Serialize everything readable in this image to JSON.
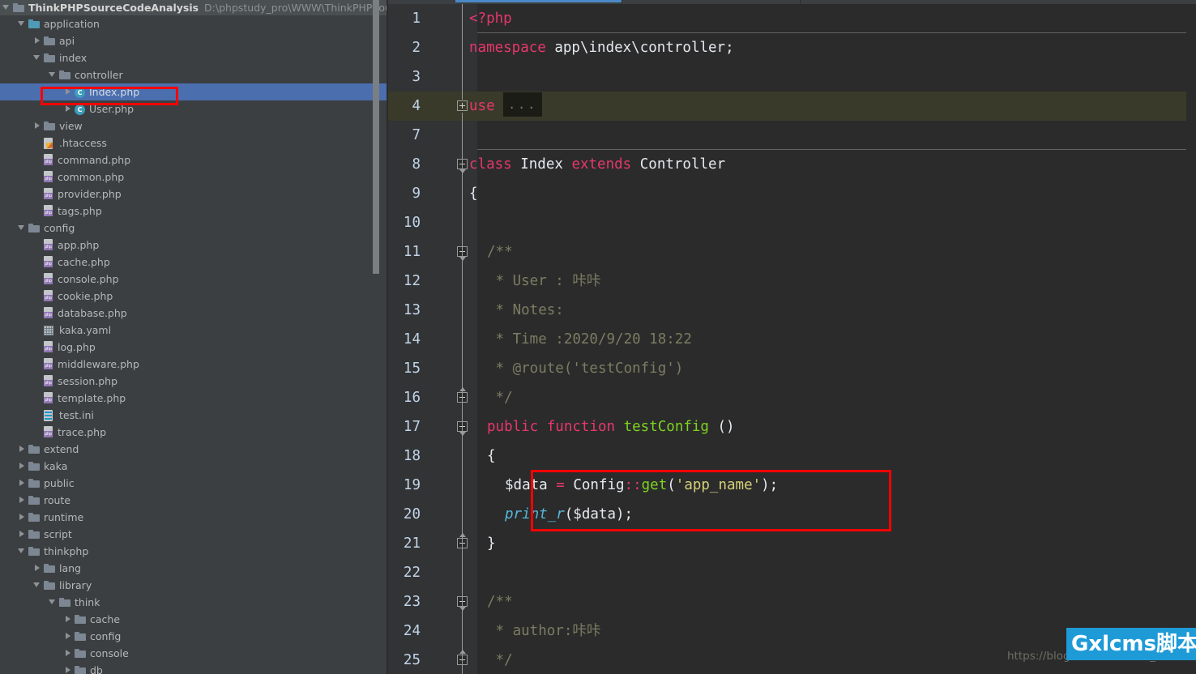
{
  "project": {
    "name": "ThinkPHPSourceCodeAnalysis",
    "path": "D:\\phpstudy_pro\\WWW\\ThinkPHPSourceC",
    "expander": "expanded-triangle-icon",
    "folder_icon": "folder-icon"
  },
  "tree": {
    "items": [
      {
        "label": "application",
        "indent": 1,
        "state": "expanded",
        "icon": "folder-src-icon",
        "selected": false
      },
      {
        "label": "api",
        "indent": 2,
        "state": "collapsed",
        "icon": "folder-icon",
        "selected": false
      },
      {
        "label": "index",
        "indent": 2,
        "state": "expanded",
        "icon": "folder-icon",
        "selected": false
      },
      {
        "label": "controller",
        "indent": 3,
        "state": "expanded",
        "icon": "folder-icon",
        "selected": false
      },
      {
        "label": "Index.php",
        "indent": 4,
        "state": "collapsed",
        "icon": "php-class-icon",
        "selected": true
      },
      {
        "label": "User.php",
        "indent": 4,
        "state": "collapsed",
        "icon": "php-class-icon",
        "selected": false
      },
      {
        "label": "view",
        "indent": 2,
        "state": "collapsed",
        "icon": "folder-icon",
        "selected": false
      },
      {
        "label": ".htaccess",
        "indent": 2,
        "state": "leaf",
        "icon": "htaccess-icon",
        "selected": false
      },
      {
        "label": "command.php",
        "indent": 2,
        "state": "leaf",
        "icon": "php-file-icon",
        "selected": false
      },
      {
        "label": "common.php",
        "indent": 2,
        "state": "leaf",
        "icon": "php-file-icon",
        "selected": false
      },
      {
        "label": "provider.php",
        "indent": 2,
        "state": "leaf",
        "icon": "php-file-icon",
        "selected": false
      },
      {
        "label": "tags.php",
        "indent": 2,
        "state": "leaf",
        "icon": "php-file-icon",
        "selected": false
      },
      {
        "label": "config",
        "indent": 1,
        "state": "expanded",
        "icon": "folder-icon",
        "selected": false
      },
      {
        "label": "app.php",
        "indent": 2,
        "state": "leaf",
        "icon": "php-file-icon",
        "selected": false
      },
      {
        "label": "cache.php",
        "indent": 2,
        "state": "leaf",
        "icon": "php-file-icon",
        "selected": false
      },
      {
        "label": "console.php",
        "indent": 2,
        "state": "leaf",
        "icon": "php-file-icon",
        "selected": false
      },
      {
        "label": "cookie.php",
        "indent": 2,
        "state": "leaf",
        "icon": "php-file-icon",
        "selected": false
      },
      {
        "label": "database.php",
        "indent": 2,
        "state": "leaf",
        "icon": "php-file-icon",
        "selected": false
      },
      {
        "label": "kaka.yaml",
        "indent": 2,
        "state": "leaf",
        "icon": "yaml-file-icon",
        "selected": false
      },
      {
        "label": "log.php",
        "indent": 2,
        "state": "leaf",
        "icon": "php-file-icon",
        "selected": false
      },
      {
        "label": "middleware.php",
        "indent": 2,
        "state": "leaf",
        "icon": "php-file-icon",
        "selected": false
      },
      {
        "label": "session.php",
        "indent": 2,
        "state": "leaf",
        "icon": "php-file-icon",
        "selected": false
      },
      {
        "label": "template.php",
        "indent": 2,
        "state": "leaf",
        "icon": "php-file-icon",
        "selected": false
      },
      {
        "label": "test.ini",
        "indent": 2,
        "state": "leaf",
        "icon": "ini-file-icon",
        "selected": false
      },
      {
        "label": "trace.php",
        "indent": 2,
        "state": "leaf",
        "icon": "php-file-icon",
        "selected": false
      },
      {
        "label": "extend",
        "indent": 1,
        "state": "collapsed",
        "icon": "folder-icon",
        "selected": false
      },
      {
        "label": "kaka",
        "indent": 1,
        "state": "collapsed",
        "icon": "folder-icon",
        "selected": false
      },
      {
        "label": "public",
        "indent": 1,
        "state": "collapsed",
        "icon": "folder-icon",
        "selected": false
      },
      {
        "label": "route",
        "indent": 1,
        "state": "collapsed",
        "icon": "folder-icon",
        "selected": false
      },
      {
        "label": "runtime",
        "indent": 1,
        "state": "collapsed",
        "icon": "folder-icon",
        "selected": false
      },
      {
        "label": "script",
        "indent": 1,
        "state": "collapsed",
        "icon": "folder-icon",
        "selected": false
      },
      {
        "label": "thinkphp",
        "indent": 1,
        "state": "expanded",
        "icon": "folder-icon",
        "selected": false
      },
      {
        "label": "lang",
        "indent": 2,
        "state": "collapsed",
        "icon": "folder-icon",
        "selected": false
      },
      {
        "label": "library",
        "indent": 2,
        "state": "expanded",
        "icon": "folder-icon",
        "selected": false
      },
      {
        "label": "think",
        "indent": 3,
        "state": "expanded",
        "icon": "folder-icon",
        "selected": false
      },
      {
        "label": "cache",
        "indent": 4,
        "state": "collapsed",
        "icon": "folder-icon",
        "selected": false
      },
      {
        "label": "config",
        "indent": 4,
        "state": "collapsed",
        "icon": "folder-icon",
        "selected": false
      },
      {
        "label": "console",
        "indent": 4,
        "state": "collapsed",
        "icon": "folder-icon",
        "selected": false
      },
      {
        "label": "db",
        "indent": 4,
        "state": "collapsed",
        "icon": "folder-icon",
        "selected": false
      }
    ]
  },
  "editor": {
    "lines": [
      {
        "num": "1",
        "indent": 0,
        "fold": "none",
        "tokens": [
          {
            "t": "<?php",
            "c": "kw"
          }
        ]
      },
      {
        "num": "2",
        "indent": 0,
        "fold": "none",
        "tokens": [
          {
            "t": "namespace",
            "c": "kw"
          },
          {
            "t": " app\\index\\controller;",
            "c": "id"
          }
        ]
      },
      {
        "num": "3",
        "indent": 0,
        "fold": "none",
        "tokens": []
      },
      {
        "num": "4",
        "indent": 0,
        "fold": "plus",
        "caret": true,
        "tokens": [
          {
            "t": "use",
            "c": "kw"
          },
          {
            "t": " ",
            "c": "id"
          },
          {
            "t": "...",
            "c": "folded"
          }
        ]
      },
      {
        "num": "7",
        "indent": 0,
        "fold": "none",
        "tokens": []
      },
      {
        "num": "8",
        "indent": 0,
        "fold": "minus-start",
        "tokens": [
          {
            "t": "class",
            "c": "kw"
          },
          {
            "t": " Index ",
            "c": "id"
          },
          {
            "t": "extends",
            "c": "kw"
          },
          {
            "t": " Controller",
            "c": "id"
          }
        ]
      },
      {
        "num": "9",
        "indent": 0,
        "fold": "none",
        "tokens": [
          {
            "t": "{",
            "c": "punct"
          }
        ]
      },
      {
        "num": "10",
        "indent": 0,
        "fold": "none",
        "tokens": []
      },
      {
        "num": "11",
        "indent": 1,
        "fold": "minus-start",
        "tokens": [
          {
            "t": "/**",
            "c": "cmt"
          }
        ]
      },
      {
        "num": "12",
        "indent": 1,
        "fold": "line",
        "tokens": [
          {
            "t": " * User : 咔咔",
            "c": "cmt"
          }
        ]
      },
      {
        "num": "13",
        "indent": 1,
        "fold": "line",
        "tokens": [
          {
            "t": " * Notes:",
            "c": "cmt"
          }
        ]
      },
      {
        "num": "14",
        "indent": 1,
        "fold": "line",
        "tokens": [
          {
            "t": " * Time :2020/9/20 18:22",
            "c": "cmt"
          }
        ]
      },
      {
        "num": "15",
        "indent": 1,
        "fold": "line",
        "tokens": [
          {
            "t": " * @route('testConfig')",
            "c": "cmt"
          }
        ]
      },
      {
        "num": "16",
        "indent": 1,
        "fold": "minus-end",
        "tokens": [
          {
            "t": " */",
            "c": "cmt"
          }
        ]
      },
      {
        "num": "17",
        "indent": 1,
        "fold": "minus-start",
        "tokens": [
          {
            "t": "public",
            "c": "kw"
          },
          {
            "t": " ",
            "c": "id"
          },
          {
            "t": "function",
            "c": "kw"
          },
          {
            "t": " ",
            "c": "id"
          },
          {
            "t": "testConfig",
            "c": "fn"
          },
          {
            "t": " ()",
            "c": "punct"
          }
        ]
      },
      {
        "num": "18",
        "indent": 1,
        "fold": "line",
        "tokens": [
          {
            "t": "{",
            "c": "punct"
          }
        ]
      },
      {
        "num": "19",
        "indent": 2,
        "fold": "line",
        "tokens": [
          {
            "t": "$data",
            "c": "var"
          },
          {
            "t": " ",
            "c": "id"
          },
          {
            "t": "=",
            "c": "op"
          },
          {
            "t": " Config",
            "c": "id"
          },
          {
            "t": "::",
            "c": "op"
          },
          {
            "t": "get",
            "c": "fn"
          },
          {
            "t": "(",
            "c": "punct"
          },
          {
            "t": "'app_name'",
            "c": "str"
          },
          {
            "t": ");",
            "c": "punct"
          }
        ]
      },
      {
        "num": "20",
        "indent": 2,
        "fold": "line",
        "tokens": [
          {
            "t": "print_r",
            "c": "cyan"
          },
          {
            "t": "($data);",
            "c": "punct"
          }
        ]
      },
      {
        "num": "21",
        "indent": 1,
        "fold": "minus-end",
        "tokens": [
          {
            "t": "}",
            "c": "punct"
          }
        ]
      },
      {
        "num": "22",
        "indent": 0,
        "fold": "none",
        "tokens": []
      },
      {
        "num": "23",
        "indent": 1,
        "fold": "minus-start",
        "tokens": [
          {
            "t": "/**",
            "c": "cmt"
          }
        ]
      },
      {
        "num": "24",
        "indent": 1,
        "fold": "line",
        "tokens": [
          {
            "t": " * author:咔咔",
            "c": "cmt"
          }
        ]
      },
      {
        "num": "25",
        "indent": 1,
        "fold": "minus-end",
        "tokens": [
          {
            "t": " */",
            "c": "cmt"
          }
        ]
      }
    ]
  },
  "annotations": {
    "index_file_box": "red-highlight-box",
    "code_box": "red-highlight-box",
    "color": "#ff0000"
  },
  "watermark": {
    "url": "https://blog.csdn.net/kaka_buaa",
    "badge": "Gxlcms脚本",
    "badge_color": "#1e9bd7"
  }
}
